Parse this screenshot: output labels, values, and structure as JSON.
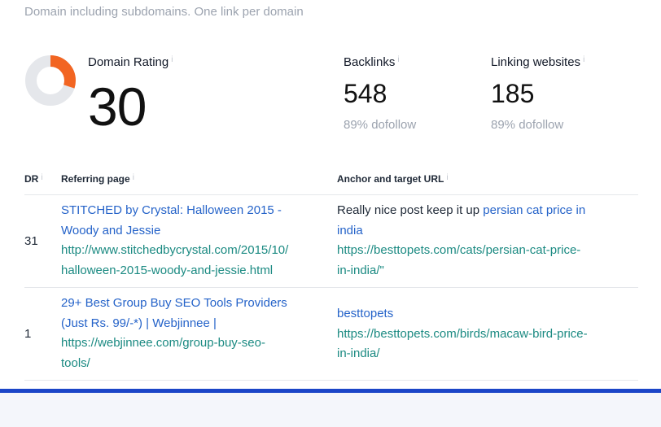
{
  "subtitle": "Domain including subdomains. One link per domain",
  "domain_rating": {
    "label": "Domain Rating",
    "info_icon": "i",
    "value": "30",
    "ring_fraction": 0.3,
    "ring_color": "#f26522",
    "track_color": "#e5e7eb"
  },
  "backlinks": {
    "label": "Backlinks",
    "info_icon": "i",
    "value": "548",
    "sub": "89% dofollow"
  },
  "linking_websites": {
    "label": "Linking websites",
    "info_icon": "i",
    "value": "185",
    "sub": "89% dofollow"
  },
  "table": {
    "headers": {
      "dr": "DR",
      "referring_page": "Referring page",
      "anchor": "Anchor and target URL",
      "info_icon": "i"
    },
    "rows": [
      {
        "dr": "31",
        "page_title_lines": [
          "STITCHED by Crystal: Halloween 2015 -",
          "Woody and Jessie"
        ],
        "page_url_lines": [
          "http://www.stitchedbycrystal.com/2015/10/",
          "halloween-2015-woody-and-jessie.html"
        ],
        "anchor_text": "Really nice post keep it up",
        "anchor_link_lines": [
          "persian cat price in",
          "india"
        ],
        "target_url_lines": [
          "https://besttopets.com/cats/persian-cat-price-",
          "in-india/\""
        ]
      },
      {
        "dr": "1",
        "page_title_lines": [
          "29+ Best Group Buy SEO Tools Providers",
          "(Just Rs. 99/-*) | Webjinnee |"
        ],
        "page_url_lines": [
          "https://webjinnee.com/group-buy-seo-",
          "tools/"
        ],
        "anchor_link_lines": [
          "besttopets"
        ],
        "target_url_lines": [
          "https://besttopets.com/birds/macaw-bird-price-",
          "in-india/"
        ]
      }
    ]
  },
  "colors": {
    "link": "#2563c9",
    "url": "#1b8a82",
    "accent_bar": "#1b45c8"
  }
}
